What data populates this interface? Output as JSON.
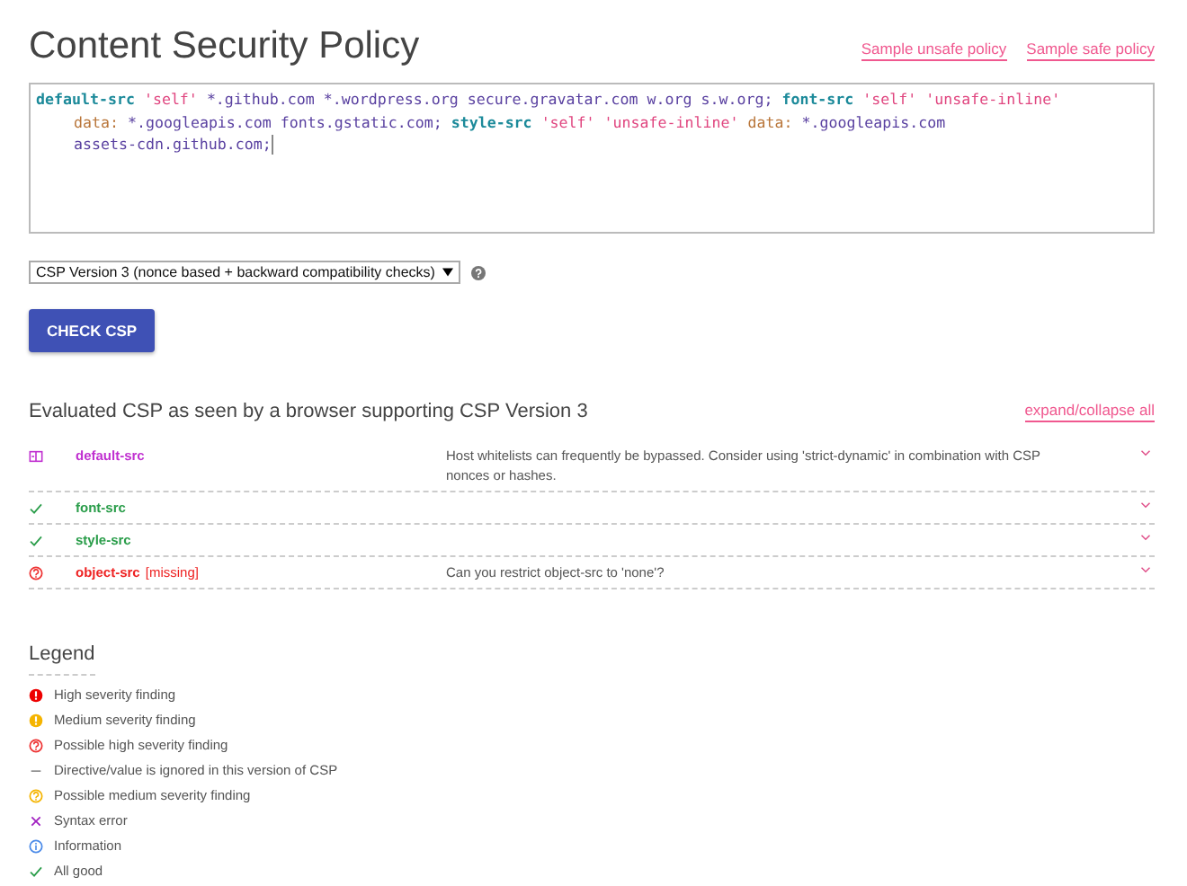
{
  "title": "Content Security Policy",
  "sample_links": [
    "Sample unsafe policy",
    "Sample safe policy"
  ],
  "policy_lines": [
    [
      {
        "kind": "directive",
        "text": "default-src"
      },
      {
        "kind": "keyword",
        "text": "'self'"
      },
      {
        "kind": "host",
        "text": "*.github.com"
      },
      {
        "kind": "host",
        "text": "*.wordpress.org"
      },
      {
        "kind": "host",
        "text": "secure.gravatar.com"
      },
      {
        "kind": "host",
        "text": "w.org"
      },
      {
        "kind": "host",
        "text": "s.w.org;"
      },
      {
        "kind": "directive",
        "text": "font-src"
      },
      {
        "kind": "keyword",
        "text": "'self'"
      },
      {
        "kind": "keyword",
        "text": "'unsafe-inline'"
      }
    ],
    [
      {
        "kind": "scheme",
        "text": "data:"
      },
      {
        "kind": "host",
        "text": "*.googleapis.com"
      },
      {
        "kind": "host",
        "text": "fonts.gstatic.com;"
      },
      {
        "kind": "directive",
        "text": "style-src"
      },
      {
        "kind": "keyword",
        "text": "'self'"
      },
      {
        "kind": "keyword",
        "text": "'unsafe-inline'"
      },
      {
        "kind": "scheme",
        "text": "data:"
      },
      {
        "kind": "host",
        "text": "*.googleapis.com"
      }
    ],
    [
      {
        "kind": "host",
        "text": "assets-cdn.github.com;"
      }
    ]
  ],
  "version_select": {
    "value": "CSP Version 3 (nonce based + backward compatibility checks)"
  },
  "check_button": "CHECK CSP",
  "evaluated_heading": "Evaluated CSP as seen by a browser supporting CSP Version 3",
  "expand_link": "expand/collapse all",
  "findings": [
    {
      "kind": "info",
      "directive": "default-src",
      "message": "Host whitelists can frequently be bypassed. Consider using 'strict-dynamic' in combination with CSP nonces or hashes."
    },
    {
      "kind": "ok",
      "directive": "font-src"
    },
    {
      "kind": "ok",
      "directive": "style-src"
    },
    {
      "kind": "possiblehigh",
      "directive": "object-src",
      "tag": "[missing]",
      "message": "Can you restrict object-src to 'none'?"
    }
  ],
  "legend_title": "Legend",
  "legend": [
    {
      "kind": "high",
      "label": "High severity finding"
    },
    {
      "kind": "medium",
      "label": "Medium severity finding"
    },
    {
      "kind": "possiblehigh",
      "label": "Possible high severity finding"
    },
    {
      "kind": "ignored",
      "label": "Directive/value is ignored in this version of CSP"
    },
    {
      "kind": "possiblemedium",
      "label": "Possible medium severity finding"
    },
    {
      "kind": "syntax",
      "label": "Syntax error"
    },
    {
      "kind": "information",
      "label": "Information"
    },
    {
      "kind": "ok",
      "label": "All good"
    }
  ]
}
